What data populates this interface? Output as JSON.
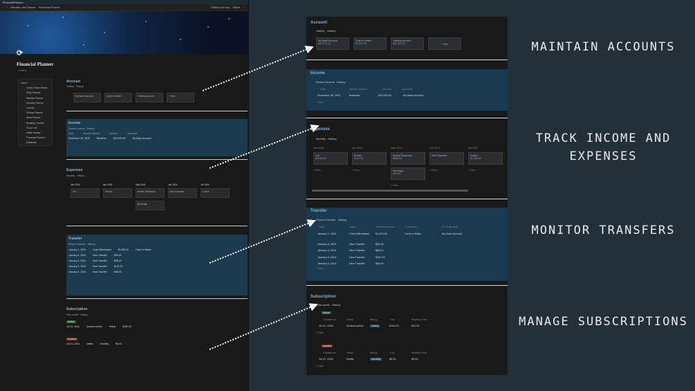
{
  "window_title": "FinancialPlanner",
  "tabs": {
    "breadcrumb": "Ultimate Life Planner",
    "page": "Financial Planner",
    "status": "Edited just now",
    "share": "Share"
  },
  "page": {
    "title": "Financial Planner",
    "subtitle": "Untitled"
  },
  "sidebar": {
    "items": [
      "Home",
      "Yearly Vision Board",
      "Daily Planner",
      "Weekly Planner",
      "Monthly Planner",
      "Journal",
      "Fitness Planner",
      "Meal Planner",
      "Reading Tracker",
      "To Do List",
      "Habit Tracker",
      "Financial Planner",
      "Database"
    ]
  },
  "accounts": {
    "title": "Account",
    "tab_gallery": "Gallery",
    "tab_history": "History",
    "cards": [
      {
        "name": "My Bank Account",
        "value": "$33,373.00"
      },
      {
        "name": "Cash in Wallet",
        "value": "$1,000.00"
      },
      {
        "name": "Trading Account",
        "value": "$12,000.00"
      }
    ],
    "new": "+ New"
  },
  "income": {
    "title": "Income",
    "tab1": "Recent Income",
    "tab2": "History",
    "cols": [
      "Date",
      "Income Stream",
      "Amount",
      "Accounts"
    ],
    "row": {
      "date": "December 28, 2023",
      "stream": "Business",
      "amount": "$15,000.00",
      "account": "My Bank Account"
    },
    "new": "+ New"
  },
  "expenses": {
    "title": "Expenses",
    "tab1": "Monthly",
    "tab2": "History",
    "columns": [
      {
        "month": "Jan 2024",
        "cards": [
          {
            "name": "Car",
            "value": "$5,000.00"
          }
        ]
      },
      {
        "month": "Apr 2024",
        "cards": [
          {
            "name": "Rental",
            "value": "$100.00"
          }
        ]
      },
      {
        "month": "May 2024",
        "cards": [
          {
            "name": "Mobile Telephone",
            "value": "$500.00"
          },
          {
            "name": "Beverage",
            "value": "$40.00"
          }
        ]
      },
      {
        "month": "Jun 2024",
        "cards": [
          {
            "name": "New Expense",
            "value": ""
          }
        ]
      },
      {
        "month": "Jul 2024",
        "cards": [
          {
            "name": "Coffee",
            "value": "$1,000.00"
          }
        ]
      }
    ],
    "new": "+ New"
  },
  "transfer": {
    "title": "Transfer",
    "tab1": "Recent Transfer",
    "tab2": "History",
    "cols": [
      "Date",
      "Name",
      "Transfer Amount",
      "To Account",
      "From Account"
    ],
    "rows": [
      {
        "date": "January 1, 2024",
        "name": "Cash Withdrawal",
        "amount": "$1,500.00",
        "to": "Cash in Wallet",
        "from": "My Bank Account"
      },
      {
        "date": "January 5, 2024",
        "name": "New Transfer",
        "amount": "$95.00",
        "to": "",
        "from": ""
      },
      {
        "date": "January 5, 2024",
        "name": "New Transfer",
        "amount": "$88.00",
        "to": "",
        "from": ""
      },
      {
        "date": "January 5, 2024",
        "name": "New Transfer",
        "amount": "$167.00",
        "to": "",
        "from": ""
      },
      {
        "date": "January 5, 2024",
        "name": "New Transfer",
        "amount": "$66.00",
        "to": "",
        "from": ""
      }
    ],
    "new": "+ New"
  },
  "subscription": {
    "title": "Subscription",
    "tab1": "This month",
    "tab2": "History",
    "groups": [
      {
        "status": "Active",
        "status_color": "#2f5e3a",
        "cols": [
          "Created on",
          "Name",
          "Billing",
          "Cost",
          "Monthly Cost"
        ],
        "row": {
          "date": "Jul 01, 2024",
          "name": "Amazon prime",
          "billing": "Yearly",
          "cost": "$150.00",
          "monthly": "$12.50"
        }
      },
      {
        "status": "Inactive",
        "status_color": "#7a3a2a",
        "cols": [
          "Created on",
          "Name",
          "Billing",
          "Cost",
          "Monthly Cost"
        ],
        "row": {
          "date": "Jul 01, 2024",
          "name": "Netflix",
          "billing": "Monthly",
          "cost": "$5.00",
          "monthly": "$5.00"
        }
      }
    ],
    "new": "+ New"
  },
  "labels": [
    "MAINTAIN ACCOUNTS",
    "TRACK INCOME AND EXPENSES",
    "MONITOR TRANSFERS",
    "MANAGE SUBSCRIPTIONS"
  ]
}
